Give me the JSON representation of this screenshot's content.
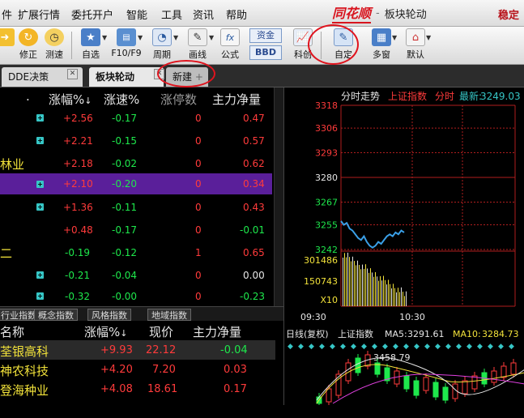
{
  "menubar": {
    "items": [
      "件",
      "扩展行情",
      "委托开户",
      "智能",
      "工具",
      "资讯",
      "帮助"
    ],
    "brand": "同花顺",
    "separator": "-",
    "window_title": "板块轮动",
    "right_text": "稳定"
  },
  "toolbar": {
    "buttons": [
      {
        "label": "",
        "icon": "arrow-icon"
      },
      {
        "label": "修正",
        "icon": "refresh-icon"
      },
      {
        "label": "测速",
        "icon": "clock-icon"
      },
      {
        "label": "自选",
        "icon": "star-list-icon"
      },
      {
        "label": "F10/F9",
        "icon": "f10-icon"
      },
      {
        "label": "周期",
        "icon": "cycle-icon"
      },
      {
        "label": "画线",
        "icon": "pencil-icon"
      },
      {
        "label": "公式",
        "icon": "formula-icon"
      },
      {
        "label": "资金",
        "icon": "fund-icon"
      },
      {
        "label": "BBD",
        "icon": "bbd-icon"
      },
      {
        "label": "科创",
        "icon": "chart-icon"
      },
      {
        "label": "自定",
        "icon": "custom-icon"
      },
      {
        "label": "多窗",
        "icon": "multi-window-icon"
      },
      {
        "label": "默认",
        "icon": "home-icon"
      }
    ]
  },
  "tabs": [
    {
      "label": "DDE决策"
    },
    {
      "label": "板块轮动"
    },
    {
      "label": "新建"
    }
  ],
  "upper_table": {
    "headers": [
      ".",
      "涨幅%",
      "涨速%",
      "涨停数",
      "主力净量"
    ],
    "rows": [
      {
        "name": "",
        "change": "+2.56",
        "speed": "-0.17",
        "limit_up": "0",
        "net": "0.47"
      },
      {
        "name": "",
        "change": "+2.21",
        "speed": "-0.15",
        "limit_up": "0",
        "net": "0.57"
      },
      {
        "name": "林业",
        "change": "+2.18",
        "speed": "-0.02",
        "limit_up": "0",
        "net": "0.62"
      },
      {
        "name": "",
        "change": "+2.10",
        "speed": "-0.20",
        "limit_up": "0",
        "net": "0.34"
      },
      {
        "name": "",
        "change": "+1.36",
        "speed": "-0.11",
        "limit_up": "0",
        "net": "0.43"
      },
      {
        "name": "",
        "change": "+0.48",
        "speed": "-0.17",
        "limit_up": "0",
        "net": "-0.01"
      },
      {
        "name": "二",
        "change": "-0.19",
        "speed": "-0.12",
        "limit_up": "1",
        "net": "0.65"
      },
      {
        "name": "",
        "change": "-0.21",
        "speed": "-0.04",
        "limit_up": "0",
        "net": "0.00"
      },
      {
        "name": "",
        "change": "-0.32",
        "speed": "-0.00",
        "limit_up": "0",
        "net": "-0.23"
      }
    ]
  },
  "subtabs": [
    "行业指数",
    "概念指数",
    "风格指数",
    "地域指数"
  ],
  "lower_table": {
    "headers": [
      "名称",
      "涨幅%",
      "现价",
      "主力净量"
    ],
    "rows": [
      {
        "name": "荃银高科",
        "change": "+9.93",
        "price": "22.12",
        "net": "-0.04"
      },
      {
        "name": "神农科技",
        "change": "+4.20",
        "price": "7.20",
        "net": "0.03"
      },
      {
        "name": "登海种业",
        "change": "+4.08",
        "price": "18.61",
        "net": "0.17"
      },
      {
        "name": "",
        "change": "",
        "price": "",
        "net": ""
      }
    ]
  },
  "intraday": {
    "title": "分时走势",
    "index_name": "上证指数",
    "period": "分时",
    "latest_label": "最新:",
    "latest_value": "3249.03",
    "y_ticks": [
      "3318",
      "3306",
      "3293",
      "3280",
      "3267",
      "3255",
      "3242"
    ],
    "volume_ticks": [
      "301486",
      "150743",
      "X10"
    ],
    "x_ticks": [
      "09:30",
      "10:30"
    ],
    "price_series": [
      3257,
      3255,
      3256,
      3253,
      3252,
      3250,
      3248,
      3247,
      3249,
      3246,
      3244,
      3243,
      3244,
      3246,
      3245,
      3247,
      3249,
      3250,
      3249,
      3251,
      3250,
      3252,
      3251
    ]
  },
  "kline": {
    "title": "日线(复权)",
    "index_name": "上证指数",
    "ma5_label": "MA5:",
    "ma5_value": "3291.61",
    "ma10_label": "MA10:",
    "ma10_value": "3284.73",
    "high_label": "3458.79"
  },
  "colors": {
    "rise": "#ff3b3b",
    "fall": "#1ee84c",
    "highlight": "#5a1f9a",
    "annotation": "#e0141e"
  }
}
